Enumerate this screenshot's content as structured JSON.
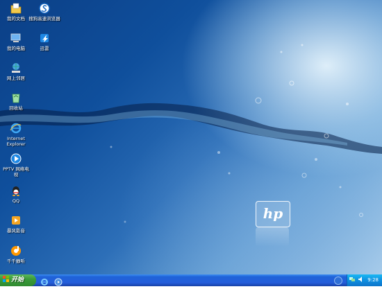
{
  "desktop_icons": [
    {
      "label": "我的文档",
      "icon": "my-documents-icon"
    },
    {
      "label": "我的电脑",
      "icon": "my-computer-icon"
    },
    {
      "label": "网上邻居",
      "icon": "network-places-icon"
    },
    {
      "label": "回收站",
      "icon": "recycle-bin-icon"
    },
    {
      "label": "Internet Explorer",
      "icon": "internet-explorer-icon"
    },
    {
      "label": "PPTV 网络电视",
      "icon": "pptv-icon"
    },
    {
      "label": "QQ",
      "icon": "qq-icon"
    },
    {
      "label": "暴风影音",
      "icon": "baofeng-icon"
    },
    {
      "label": "千千静听",
      "icon": "ttplayer-icon"
    },
    {
      "label": "搜狗高速浏览器",
      "icon": "sogou-browser-icon"
    },
    {
      "label": "迅雷",
      "icon": "xunlei-icon"
    }
  ],
  "wallpaper": {
    "logo_text": "hp"
  },
  "taskbar": {
    "start_label": "开始",
    "quicklaunch": [
      "ie-icon",
      "media-icon"
    ],
    "tray_icons": [
      "network-icon",
      "volume-icon"
    ],
    "clock": "9:28"
  },
  "colors": {
    "taskbar": "#245edb",
    "start": "#3a9b3a",
    "tray": "#0f8fe0"
  }
}
